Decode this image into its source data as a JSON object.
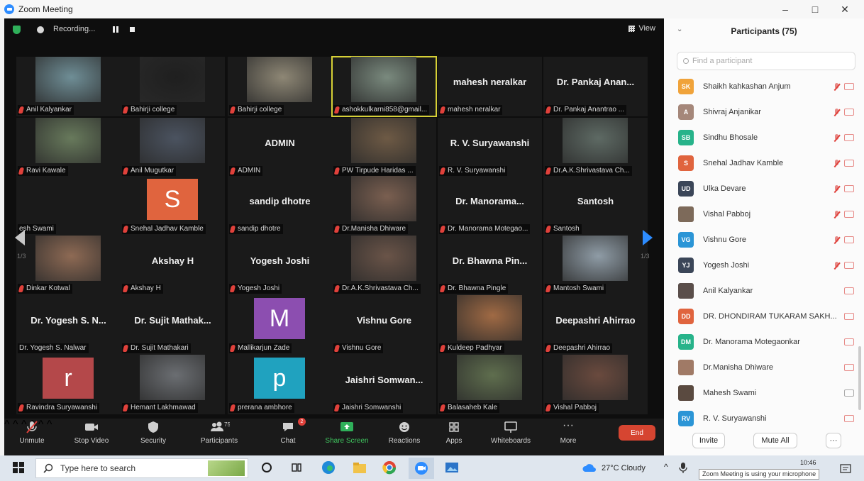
{
  "window": {
    "title": "Zoom Meeting",
    "controls": [
      "–",
      "□",
      "✕"
    ]
  },
  "meeting_bar": {
    "recording_label": "Recording...",
    "view_label": "View"
  },
  "pages": {
    "left": "1/3",
    "right": "1/3"
  },
  "tiles": [
    {
      "label": "Anil Kalyankar",
      "video": "#6f8e96"
    },
    {
      "label": "Bahirji college",
      "video": "#1f1f1f"
    },
    {
      "label": "Bahirji college",
      "video": "#8e8775"
    },
    {
      "label": "ashokkulkarni858@gmail...",
      "video": "#7a8a7e",
      "active": true
    },
    {
      "label": "mahesh neralkar",
      "name": "mahesh neralkar"
    },
    {
      "label": "Dr. Pankaj Anantrao ...",
      "name": "Dr. Pankaj Anan..."
    },
    {
      "label": "Ravi Kawale",
      "video": "#687a5c"
    },
    {
      "label": "Anil Mugutkar",
      "video": "#4b5360"
    },
    {
      "label": "ADMIN",
      "name": "ADMIN"
    },
    {
      "label": "PW Tirpude Haridas ...",
      "video": "#6e5a45"
    },
    {
      "label": "R. V. Suryawanshi",
      "name": "R. V. Suryawanshi"
    },
    {
      "label": "Dr.A.K.Shrivastava Ch...",
      "video": "#5e6a64"
    },
    {
      "label": "esh Swami"
    },
    {
      "label": "Snehal Jadhav Kamble",
      "avatar": "S",
      "avatar_color": "#e0643e"
    },
    {
      "label": "sandip dhotre",
      "name": "sandip dhotre"
    },
    {
      "label": "Dr.Manisha Dhiware",
      "video": "#7a5f50"
    },
    {
      "label": "Dr. Manorama Motegao...",
      "name": "Dr. Manorama..."
    },
    {
      "label": "Santosh",
      "name": "Santosh"
    },
    {
      "label": "Dinkar Kotwal",
      "video": "#8e6a54"
    },
    {
      "label": "Akshay H",
      "name": "Akshay H"
    },
    {
      "label": "Yogesh Joshi",
      "name": "Yogesh Joshi"
    },
    {
      "label": "Dr.A.K.Shrivastava Ch...",
      "video": "#6a5448"
    },
    {
      "label": "Dr. Bhawna Pingle",
      "name": "Dr. Bhawna Pin..."
    },
    {
      "label": "Mantosh Swami",
      "video": "#8f9ca6"
    },
    {
      "label": "Dr. Yogesh S. Nalwar",
      "name": "Dr. Yogesh S. N..."
    },
    {
      "label": "Dr. Sujit Mathakari",
      "name": "Dr. Sujit Mathak..."
    },
    {
      "label": "Mallikarjun Zade",
      "avatar": "M",
      "avatar_color": "#8c4eb0"
    },
    {
      "label": "Vishnu Gore",
      "name": "Vishnu Gore"
    },
    {
      "label": "Kuldeep Padhyar",
      "video": "#a06a44"
    },
    {
      "label": "Deepashri Ahirrao",
      "name": "Deepashri Ahirrao"
    },
    {
      "label": "Ravindra Suryawanshi",
      "avatar": "r",
      "avatar_color": "#b4484a"
    },
    {
      "label": "Hemant Lakhmawad",
      "video": "#6b6e72"
    },
    {
      "label": "prerana ambhore",
      "avatar": "p",
      "avatar_color": "#20a2bf"
    },
    {
      "label": "Jaishri Somwanshi",
      "name": "Jaishri Somwan..."
    },
    {
      "label": "Balasaheb Kale",
      "video": "#5f6e4e"
    },
    {
      "label": "Vishal Pabboj",
      "video": "#6a4a3e"
    }
  ],
  "toolbar": {
    "unmute": "Unmute",
    "stop_video": "Stop Video",
    "security": "Security",
    "participants": "Participants",
    "participants_count": "75",
    "chat": "Chat",
    "chat_badge": "2",
    "share_screen": "Share Screen",
    "reactions": "Reactions",
    "apps": "Apps",
    "whiteboards": "Whiteboards",
    "more": "More",
    "end": "End"
  },
  "panel": {
    "title": "Participants (75)",
    "search_placeholder": "Find a participant",
    "invite": "Invite",
    "mute_all": "Mute All",
    "more": "···"
  },
  "participants": [
    {
      "initials": "SK",
      "color": "#f0a33a",
      "name": "Shaikh kahkashan Anjum",
      "mic": true,
      "cam": "red"
    },
    {
      "initials": "A",
      "color": "#a5877a",
      "name": "Shivraj Anjanikar",
      "mic": true,
      "cam": "red"
    },
    {
      "initials": "SB",
      "color": "#27b38a",
      "name": "Sindhu Bhosale",
      "mic": true,
      "cam": "red"
    },
    {
      "initials": "S",
      "color": "#e0643e",
      "name": "Snehal Jadhav Kamble",
      "mic": true,
      "cam": "red"
    },
    {
      "initials": "UD",
      "color": "#3b4658",
      "name": "Ulka Devare",
      "mic": true,
      "cam": "red"
    },
    {
      "initials": "",
      "color": "#7d6a5a",
      "name": "Vishal Pabboj",
      "mic": true,
      "cam": "red"
    },
    {
      "initials": "VG",
      "color": "#2b95d6",
      "name": "Vishnu Gore",
      "mic": true,
      "cam": "red"
    },
    {
      "initials": "YJ",
      "color": "#3b4658",
      "name": "Yogesh Joshi",
      "mic": true,
      "cam": "red"
    },
    {
      "initials": "",
      "color": "#5a4e4a",
      "name": "Anil Kalyankar",
      "mic": false,
      "cam": "red"
    },
    {
      "initials": "DD",
      "color": "#e0643e",
      "name": "DR. DHONDIRAM TUKARAM SAKH...",
      "mic": false,
      "cam": "red"
    },
    {
      "initials": "DM",
      "color": "#27b38a",
      "name": "Dr. Manorama Motegaonkar",
      "mic": false,
      "cam": "red"
    },
    {
      "initials": "",
      "color": "#a07a66",
      "name": "Dr.Manisha Dhiware",
      "mic": false,
      "cam": "red"
    },
    {
      "initials": "",
      "color": "#5a4a40",
      "name": "Mahesh Swami",
      "mic": false,
      "cam": "gray"
    },
    {
      "initials": "RV",
      "color": "#2b95d6",
      "name": "R. V. Suryawanshi",
      "mic": false,
      "cam": "red"
    }
  ],
  "taskbar": {
    "search_placeholder": "Type here to search",
    "weather": "27°C  Cloudy",
    "tooltip": "Zoom Meeting is using your microphone",
    "time": "10:46"
  }
}
